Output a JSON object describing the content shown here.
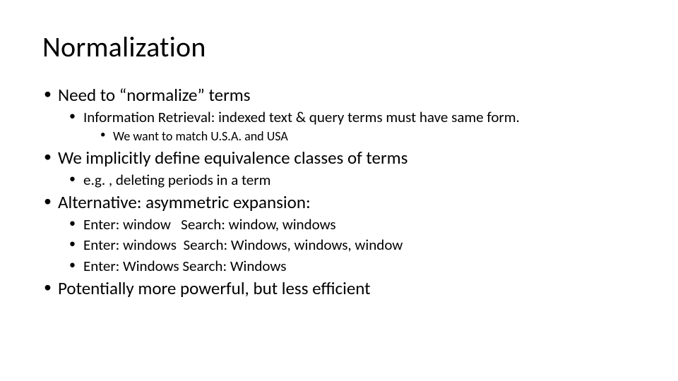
{
  "slide": {
    "title": "Normalization",
    "bullets": [
      {
        "text": "Need to “normalize” terms",
        "children": [
          {
            "text": "Information Retrieval: indexed text & query terms must have same form.",
            "children": [
              {
                "text": "We want to match U.S.A. and USA"
              }
            ]
          }
        ]
      },
      {
        "text": "We implicitly define equivalence classes of terms",
        "children": [
          {
            "text": "e.g. , deleting periods in a term"
          }
        ]
      },
      {
        "text": "Alternative: asymmetric expansion:",
        "children": [
          {
            "text": "Enter: window   Search: window, windows"
          },
          {
            "text": "Enter: windows  Search: Windows, windows, window"
          },
          {
            "text": "Enter: Windows Search: Windows"
          }
        ]
      },
      {
        "text": "Potentially more powerful, but less efficient"
      }
    ]
  }
}
